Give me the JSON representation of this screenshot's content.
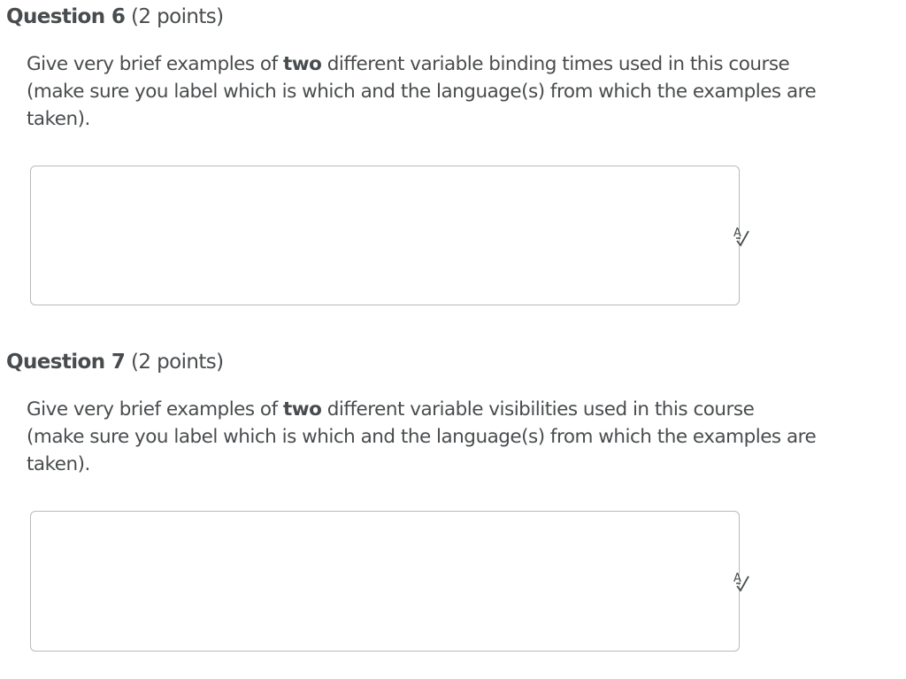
{
  "questions": [
    {
      "number_label": "Question 6",
      "points_label": "(2 points)",
      "prompt": {
        "line1_pre": "Give very brief examples of ",
        "line1_bold": "two",
        "line1_post": " different variable binding times used in this course",
        "line2": "(make sure you label which is which and the language(s) from which the examples are",
        "line3": "taken)."
      },
      "answer_value": "",
      "spellcheck_icon": "spell-check-icon"
    },
    {
      "number_label": "Question 7",
      "points_label": "(2 points)",
      "prompt": {
        "line1_pre": "Give very brief examples of ",
        "line1_bold": "two",
        "line1_post": " different variable visibilities used in this course",
        "line2": "(make sure you label which is which and the language(s) from which the examples are",
        "line3": "taken)."
      },
      "answer_value": "",
      "spellcheck_icon": "spell-check-icon"
    }
  ]
}
